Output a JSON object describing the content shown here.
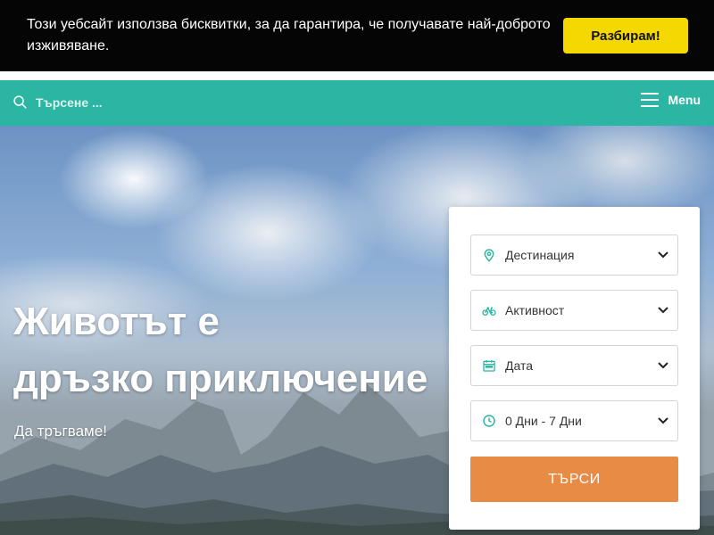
{
  "cookie_banner": {
    "text": "Този уебсайт използва бисквитки, за да гарантира, че получавате най-доброто изживяване.",
    "accept_label": "Разбирам!"
  },
  "nav": {
    "search_placeholder": "Търсене ...",
    "menu_label": "Menu",
    "background_color": "#2bb5a3"
  },
  "hero": {
    "title_line1": "Животът е",
    "title_line2": "дръзко приключение",
    "subtitle": "Да тръгваме!"
  },
  "search_panel": {
    "fields": [
      {
        "label": "Дестинация",
        "icon": "map-pin-icon"
      },
      {
        "label": "Активност",
        "icon": "bicycle-icon"
      },
      {
        "label": "Дата",
        "icon": "calendar-icon"
      },
      {
        "label": "0 Дни - 7 Дни",
        "icon": "clock-icon"
      }
    ],
    "submit_label": "ТЪРСИ",
    "submit_color": "#e88c45",
    "icon_color": "#2bb5a3"
  }
}
